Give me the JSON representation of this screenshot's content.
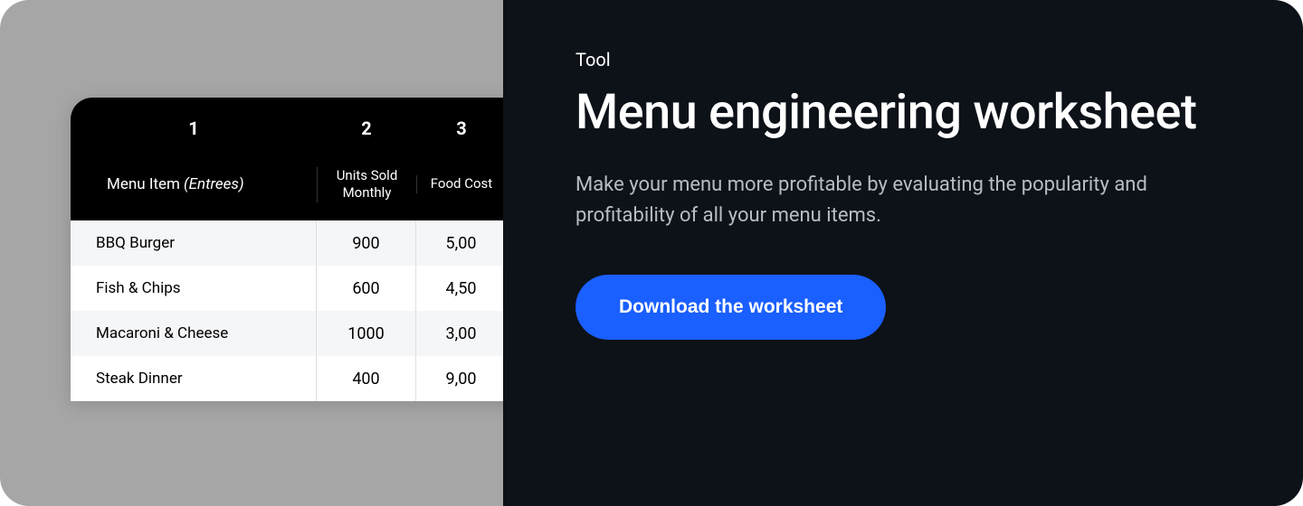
{
  "worksheet": {
    "columns": {
      "num1": "1",
      "num2": "2",
      "num3": "3",
      "label1_prefix": "Menu Item",
      "label1_suffix": "(Entrees)",
      "label2": "Units Sold Monthly",
      "label3": "Food Cost"
    },
    "rows": [
      {
        "item": "BBQ Burger",
        "units": "900",
        "cost": "5,00"
      },
      {
        "item": "Fish & Chips",
        "units": "600",
        "cost": "4,50"
      },
      {
        "item": "Macaroni & Cheese",
        "units": "1000",
        "cost": "3,00"
      },
      {
        "item": "Steak Dinner",
        "units": "400",
        "cost": "9,00"
      }
    ]
  },
  "card": {
    "eyebrow": "Tool",
    "heading": "Menu engineering worksheet",
    "description": "Make your menu more profitable by evaluating the popularity and profitability of all your menu items.",
    "cta": "Download the worksheet"
  }
}
